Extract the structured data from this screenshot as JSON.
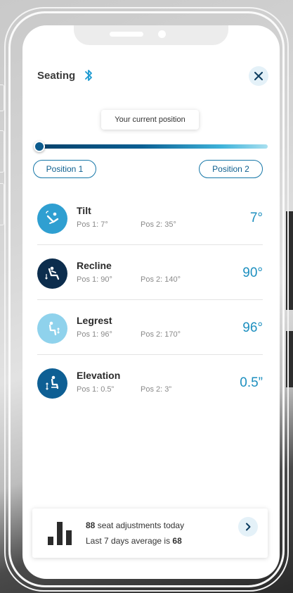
{
  "header": {
    "title": "Seating"
  },
  "slider": {
    "tooltip": "Your current position",
    "current_fraction": 0.0,
    "position1_label": "Position 1",
    "position2_label": "Position 2",
    "track_colors": [
      "#06416a",
      "#3fb3da",
      "#a9e0f0"
    ]
  },
  "settings": [
    {
      "name": "Tilt",
      "pos1": "Pos 1: 7°",
      "pos2": "Pos 2: 35°",
      "value": "7°",
      "icon": "tilt-icon",
      "icon_color": "#2f9fd1"
    },
    {
      "name": "Recline",
      "pos1": "Pos 1: 90°",
      "pos2": "Pos 2: 140°",
      "value": "90°",
      "icon": "recline-icon",
      "icon_color": "#0c2d4d"
    },
    {
      "name": "Legrest",
      "pos1": "Pos 1: 96°",
      "pos2": "Pos 2: 170°",
      "value": "96°",
      "icon": "legrest-icon",
      "icon_color": "#8fd2ec"
    },
    {
      "name": "Elevation",
      "pos1": "Pos 1: 0.5”",
      "pos2": "Pos 2: 3”",
      "value": "0.5”",
      "icon": "elevation-icon",
      "icon_color": "#0e5f94"
    }
  ],
  "summary": {
    "adjustments_count": "88",
    "adjustments_text": " seat adjustments today",
    "average_prefix": "Last 7 days average is ",
    "average_value": "68"
  },
  "colors": {
    "accent": "#1d8fbf",
    "dark_blue": "#0c5b8d",
    "light_blue_bg": "#e4f1f8"
  }
}
